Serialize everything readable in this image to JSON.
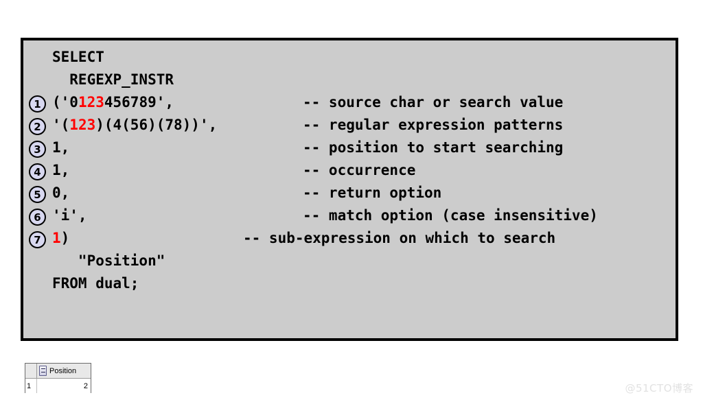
{
  "colors": {
    "box_background": "#cccccc",
    "box_border": "#000000",
    "text": "#000000",
    "highlight_red": "#ff0000",
    "badge_fill": "#d8d8f0",
    "watermark": "#e2e2e2"
  },
  "code": {
    "lines": [
      {
        "badge": "",
        "segments": [
          {
            "text": "SELECT",
            "color": "black"
          }
        ],
        "comment": ""
      },
      {
        "badge": "",
        "segments": [
          {
            "text": "  REGEXP_INSTR",
            "color": "black"
          }
        ],
        "comment": ""
      },
      {
        "badge": "1",
        "segments": [
          {
            "text": "('0",
            "color": "black"
          },
          {
            "text": "123",
            "color": "red"
          },
          {
            "text": "456789',",
            "color": "black"
          }
        ],
        "comment": "-- source char or search value"
      },
      {
        "badge": "2",
        "segments": [
          {
            "text": "'(",
            "color": "black"
          },
          {
            "text": "123",
            "color": "red"
          },
          {
            "text": ")(4(56)(78))',",
            "color": "black"
          }
        ],
        "comment": "-- regular expression patterns"
      },
      {
        "badge": "3",
        "segments": [
          {
            "text": "1,",
            "color": "black"
          }
        ],
        "comment": "-- position to start searching"
      },
      {
        "badge": "4",
        "segments": [
          {
            "text": "1,",
            "color": "black"
          }
        ],
        "comment": "-- occurrence"
      },
      {
        "badge": "5",
        "segments": [
          {
            "text": "0,",
            "color": "black"
          }
        ],
        "comment": "-- return option"
      },
      {
        "badge": "6",
        "segments": [
          {
            "text": "'i',",
            "color": "black"
          }
        ],
        "comment": "-- match option (case insensitive)"
      },
      {
        "badge": "7",
        "segments": [
          {
            "text": "1",
            "color": "red"
          },
          {
            "text": ")",
            "color": "black"
          }
        ],
        "comment": "-- sub-expression on which to search"
      },
      {
        "badge": "",
        "segments": [
          {
            "text": "   \"Position\"",
            "color": "black"
          }
        ],
        "comment": ""
      },
      {
        "badge": "",
        "segments": [
          {
            "text": "FROM dual;",
            "color": "black"
          }
        ],
        "comment": ""
      }
    ]
  },
  "result_grid": {
    "row_number_header": "",
    "column_header": "Position",
    "column_type_icon": "sort-data-type-icon",
    "rows": [
      {
        "row_number": "1",
        "value": "2"
      }
    ]
  },
  "watermark": {
    "text": "@51CTO博客"
  }
}
